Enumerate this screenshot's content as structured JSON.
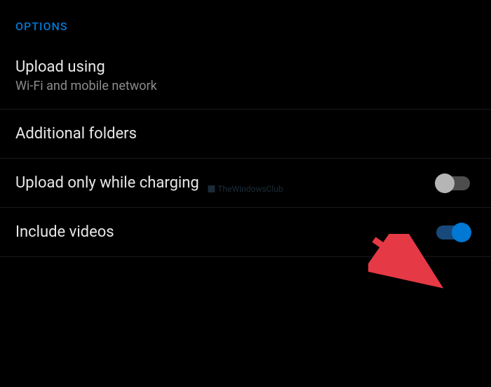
{
  "section": {
    "header": "OPTIONS"
  },
  "settings": {
    "upload_using": {
      "title": "Upload using",
      "subtitle": "Wi-Fi and mobile network"
    },
    "additional_folders": {
      "title": "Additional folders"
    },
    "upload_only_while_charging": {
      "title": "Upload only while charging",
      "enabled": false
    },
    "include_videos": {
      "title": "Include videos",
      "enabled": true
    }
  },
  "watermark": "TheWindowsClub"
}
